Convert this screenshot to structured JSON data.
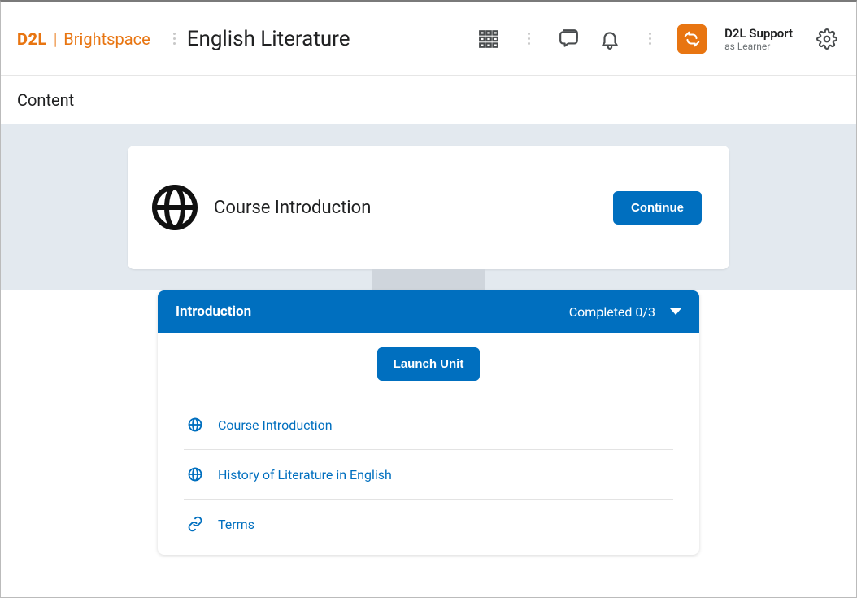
{
  "brand": {
    "logo_d2l": "D2L",
    "logo_brand": "Brightspace"
  },
  "course_title": "English Literature",
  "user": {
    "name": "D2L Support",
    "role": "as Learner"
  },
  "subnav": {
    "content": "Content"
  },
  "intro": {
    "title": "Course Introduction",
    "continue_label": "Continue"
  },
  "unit": {
    "title": "Introduction",
    "completed_label": "Completed 0/3",
    "launch_label": "Launch Unit",
    "items": [
      {
        "icon": "globe",
        "label": "Course Introduction"
      },
      {
        "icon": "globe",
        "label": "History of Literature in English"
      },
      {
        "icon": "link",
        "label": "Terms"
      }
    ]
  }
}
